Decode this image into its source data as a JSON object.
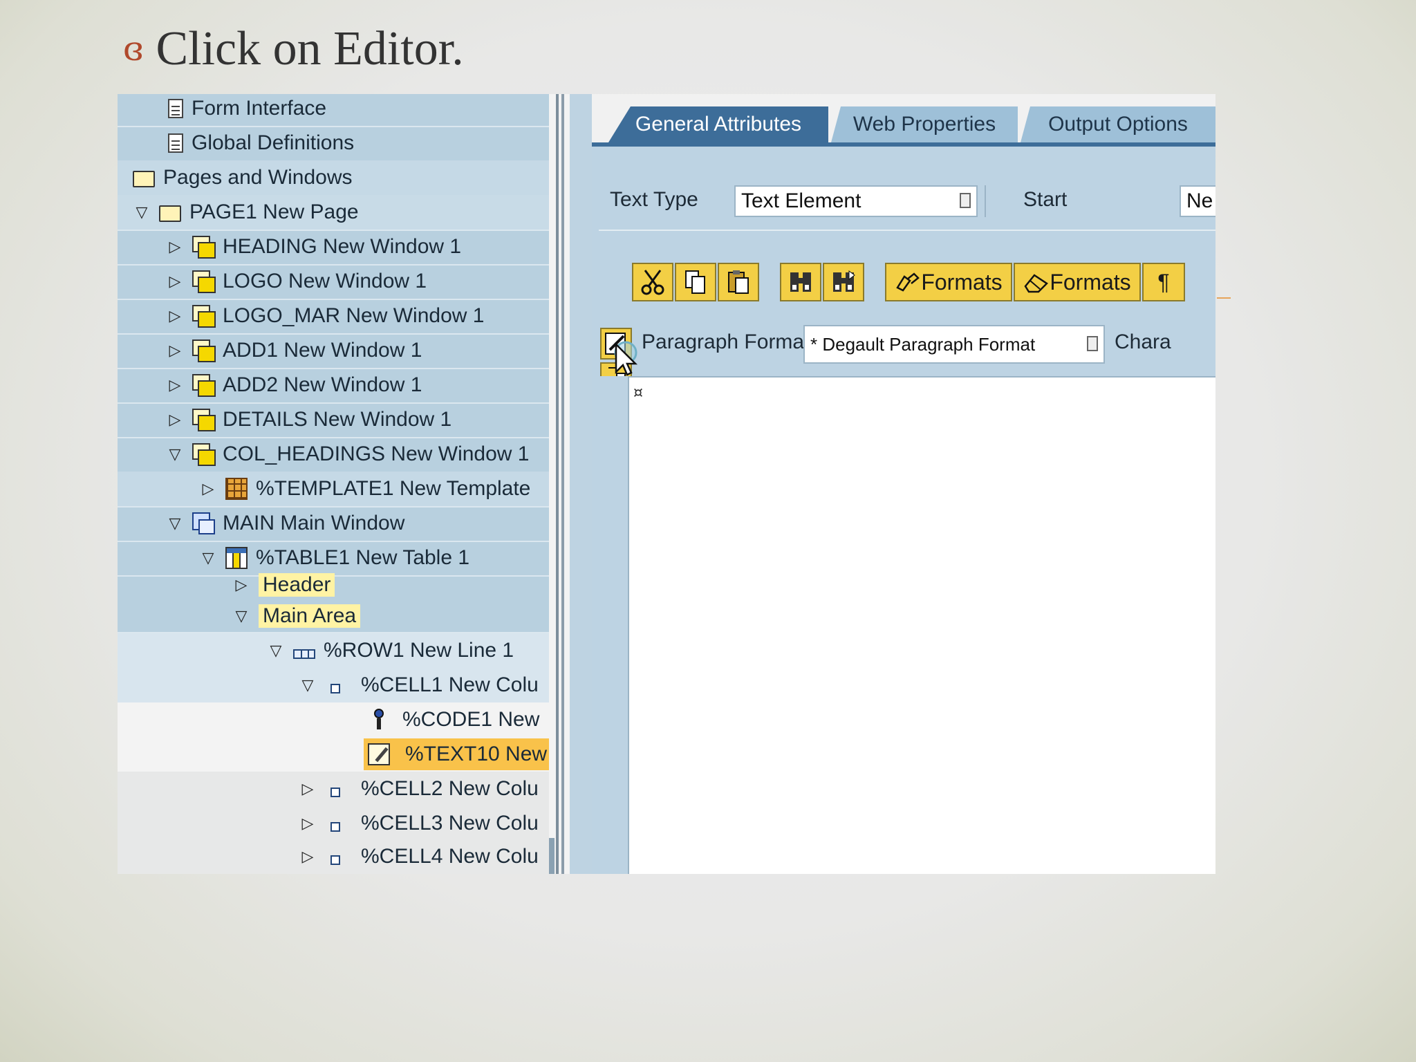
{
  "slide": {
    "bullet": "ɞ",
    "title": "Click on Editor."
  },
  "tree": {
    "rows": [
      {
        "label": "Form Interface"
      },
      {
        "label": "Global Definitions"
      },
      {
        "label": "Pages and Windows"
      },
      {
        "label": "PAGE1 New Page"
      },
      {
        "label": "HEADING New Window 1"
      },
      {
        "label": "LOGO New Window 1"
      },
      {
        "label": "LOGO_MAR New Window 1"
      },
      {
        "label": "ADD1 New Window 1"
      },
      {
        "label": "ADD2 New Window 1"
      },
      {
        "label": "DETAILS New Window 1"
      },
      {
        "label": "COL_HEADINGS New Window 1"
      },
      {
        "label": "%TEMPLATE1 New Template"
      },
      {
        "label": "MAIN Main Window"
      },
      {
        "label": "%TABLE1 New Table 1"
      },
      {
        "label": "Header"
      },
      {
        "label": "Main Area"
      },
      {
        "label": "%ROW1 New Line 1"
      },
      {
        "label": "%CELL1 New Colu"
      },
      {
        "label": "%CODE1 New"
      },
      {
        "label": "%TEXT10 New"
      },
      {
        "label": "%CELL2 New Colu"
      },
      {
        "label": "%CELL3 New Colu"
      },
      {
        "label": "%CELL4 New Colu"
      }
    ]
  },
  "tabs": [
    {
      "label": "General Attributes",
      "active": true
    },
    {
      "label": "Web Properties"
    },
    {
      "label": "Output Options"
    }
  ],
  "fields": {
    "text_type_label": "Text Type",
    "text_type_value": "Text Element",
    "start_label": "Start",
    "start_value": "Ne",
    "paragraph_formats_label": "Paragraph Formats",
    "paragraph_formats_value": "* Degault Paragraph Format",
    "character_formats_label": "Chara"
  },
  "toolbar": {
    "formats_1": "Formats",
    "formats_2": "Formats",
    "pilcrow": "¶"
  },
  "editor": {
    "mark": "¤"
  },
  "colors": {
    "tab_active": "#3d6d99",
    "tree_bg": "#b8d0df",
    "button_yellow": "#f3cf45",
    "selected_node": "#f9c24a"
  }
}
